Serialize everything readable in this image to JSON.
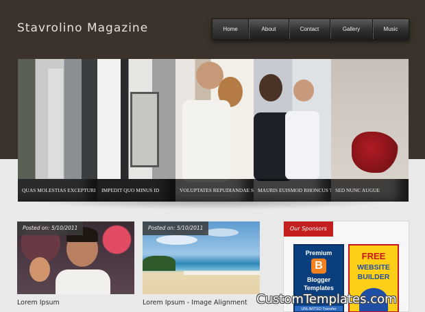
{
  "site": {
    "title": "Stavrolino Magazine"
  },
  "nav": {
    "items": [
      {
        "label": "Home"
      },
      {
        "label": "About"
      },
      {
        "label": "Contact"
      },
      {
        "label": "Gallery"
      },
      {
        "label": "Music"
      }
    ]
  },
  "slider": {
    "slides": [
      {
        "caption": "QUAS MOLESTIAS EXCEPTURI"
      },
      {
        "caption": "IMPEDIT QUO MINUS ID"
      },
      {
        "caption": "VOLUPTATES REPUDIANDAE SINT"
      },
      {
        "caption": "MAURIS EUISMOD RHONCUS TORTOR"
      },
      {
        "caption": "SED NUNC AUGUE"
      }
    ]
  },
  "posts": [
    {
      "date": "Posted on: 5/10/2011",
      "title": "Lorem Ipsum"
    },
    {
      "date": "Posted on: 5/10/2011",
      "title": "Lorem Ipsum - Image Alignment"
    }
  ],
  "sidebar": {
    "heading": "Our Sponsors",
    "ads": [
      {
        "lines": [
          "Premium",
          "Blogger",
          "Templates"
        ],
        "footer": "UNLIMITED Transfer"
      },
      {
        "lines": [
          "FREE",
          "WEBSITE",
          "BUILDER"
        ]
      }
    ]
  },
  "watermark": "CustomTemplates.com",
  "colors": {
    "header_bg": "#3a322b",
    "accent_red": "#c41f1f",
    "page_bg": "#e9e9e9"
  }
}
